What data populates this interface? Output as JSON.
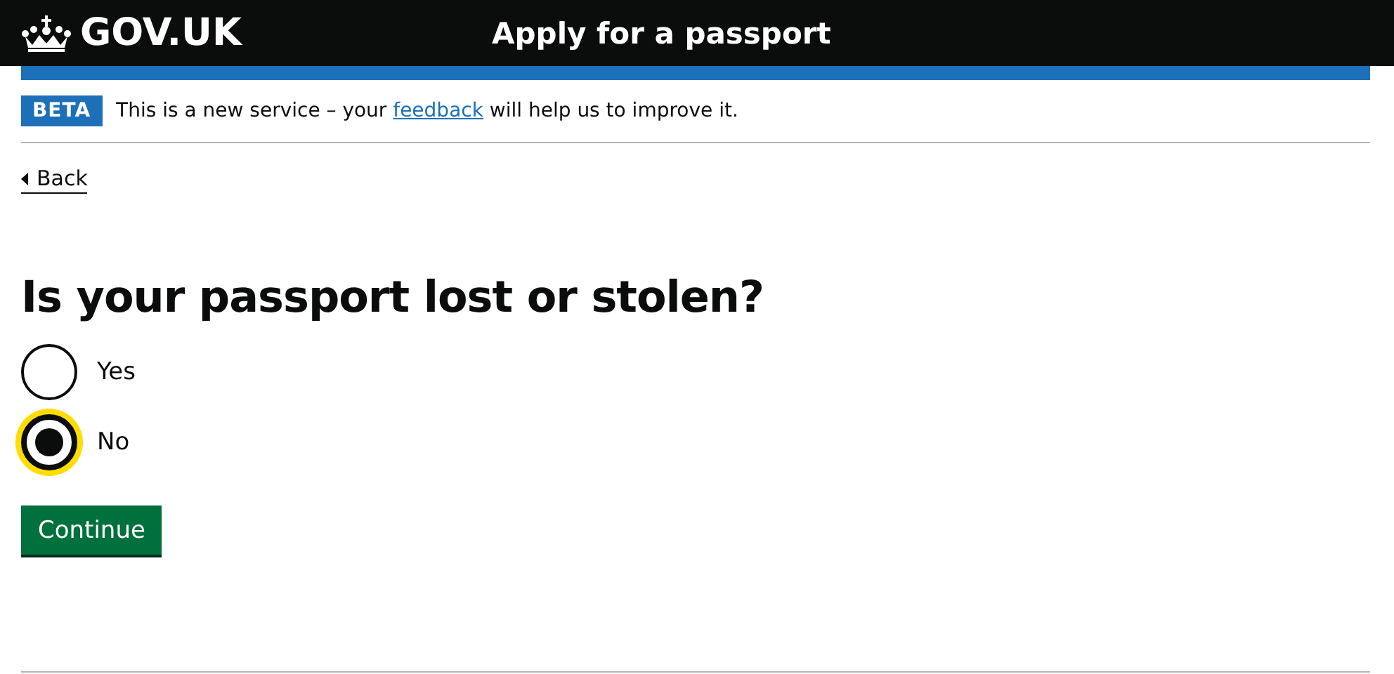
{
  "header": {
    "logo": "GOV.UK",
    "service_name": "Apply for a passport"
  },
  "phase_banner": {
    "tag": "BETA",
    "text_before": "This is a new service – your",
    "link": "feedback",
    "text_after": "will help us to improve it."
  },
  "back_link": "Back",
  "question": "Is your passport lost or stolen?",
  "options": [
    {
      "label": "Yes",
      "selected": false,
      "focused": false
    },
    {
      "label": "No",
      "selected": true,
      "focused": true
    }
  ],
  "button": "Continue"
}
